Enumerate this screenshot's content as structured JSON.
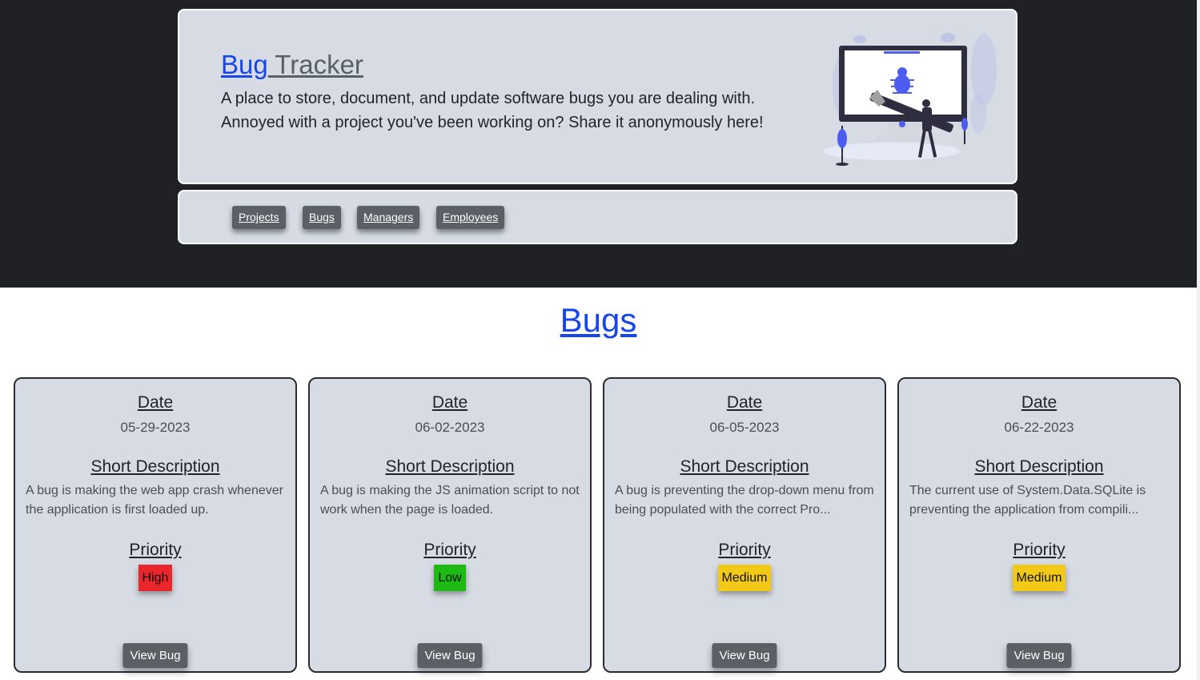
{
  "header": {
    "title_link": "Bug",
    "title_rest": " Tracker",
    "description_line1": "A place to store, document, and update software bugs you are dealing with.",
    "description_line2": "Annoyed with a project you've been working on? Share it anonymously here!"
  },
  "nav": {
    "items": [
      {
        "label": "Projects"
      },
      {
        "label": "Bugs"
      },
      {
        "label": "Managers"
      },
      {
        "label": "Employees"
      }
    ]
  },
  "page": {
    "title": "Bugs"
  },
  "labels": {
    "date": "Date",
    "short_description": "Short Description",
    "priority": "Priority",
    "view_button": "View Bug"
  },
  "bugs": [
    {
      "date": "05-29-2023",
      "description": "A bug is making the web app crash whenever the application is first loaded up.",
      "priority": "High",
      "priority_color": "#e8262b"
    },
    {
      "date": "06-02-2023",
      "description": "A bug is making the JS animation script to not work when the page is loaded.",
      "priority": "Low",
      "priority_color": "#1cba13"
    },
    {
      "date": "06-05-2023",
      "description": "A bug is preventing the drop-down menu from being populated with the correct Pro...",
      "priority": "Medium",
      "priority_color": "#f3c917"
    },
    {
      "date": "06-22-2023",
      "description": "The current use of System.Data.SQLite is preventing the application from compili...",
      "priority": "Medium",
      "priority_color": "#f3c917"
    }
  ],
  "colors": {
    "accent_link": "#1846e8",
    "band": "#1f2124",
    "panel": "#d7dce4",
    "button": "#5b5f66"
  }
}
